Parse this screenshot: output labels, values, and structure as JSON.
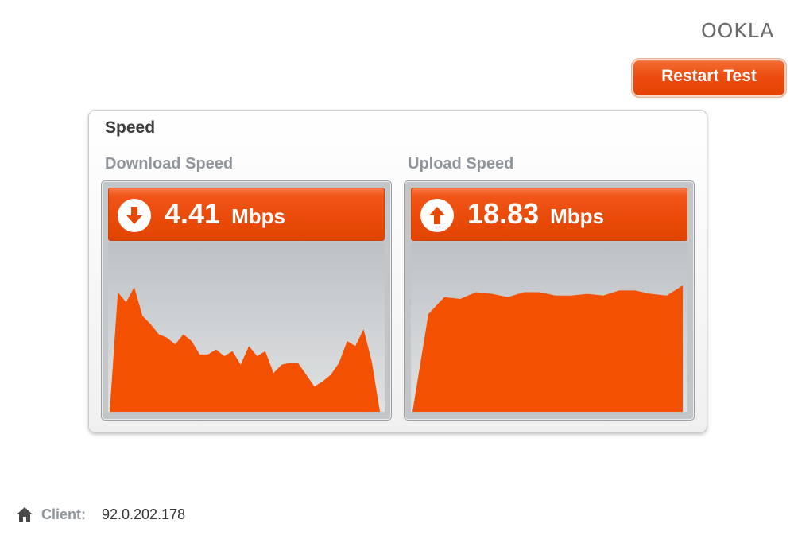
{
  "brand": {
    "logo_text": "OOKLA"
  },
  "toolbar": {
    "restart_label": "Restart Test"
  },
  "panel": {
    "title": "Speed"
  },
  "download": {
    "label": "Download Speed",
    "value": "4.41",
    "unit": "Mbps",
    "icon": "arrow-down-circle-icon"
  },
  "upload": {
    "label": "Upload Speed",
    "value": "18.83",
    "unit": "Mbps",
    "icon": "arrow-up-circle-icon"
  },
  "client": {
    "label": "Client:",
    "ip": "92.0.202.178",
    "icon": "home-icon"
  },
  "colors": {
    "accent": "#e84a06",
    "graph_fill": "#f35000",
    "label_gray": "#8f959a"
  },
  "chart_data": [
    {
      "type": "area",
      "series": [
        {
          "values": [
            0.0,
            0.71,
            0.65,
            0.74,
            0.57,
            0.52,
            0.46,
            0.44,
            0.4,
            0.46,
            0.42,
            0.34,
            0.34,
            0.37,
            0.33,
            0.36,
            0.28,
            0.39,
            0.33,
            0.36,
            0.23,
            0.28,
            0.29,
            0.29,
            0.22,
            0.15,
            0.18,
            0.22,
            0.29,
            0.42,
            0.39,
            0.49,
            0.3,
            0.0
          ]
        }
      ]
    },
    {
      "type": "area",
      "series": [
        {
          "values": [
            0.0,
            0.58,
            0.68,
            0.67,
            0.71,
            0.7,
            0.68,
            0.71,
            0.71,
            0.69,
            0.69,
            0.7,
            0.69,
            0.72,
            0.72,
            0.7,
            0.69,
            0.75
          ]
        }
      ]
    }
  ]
}
